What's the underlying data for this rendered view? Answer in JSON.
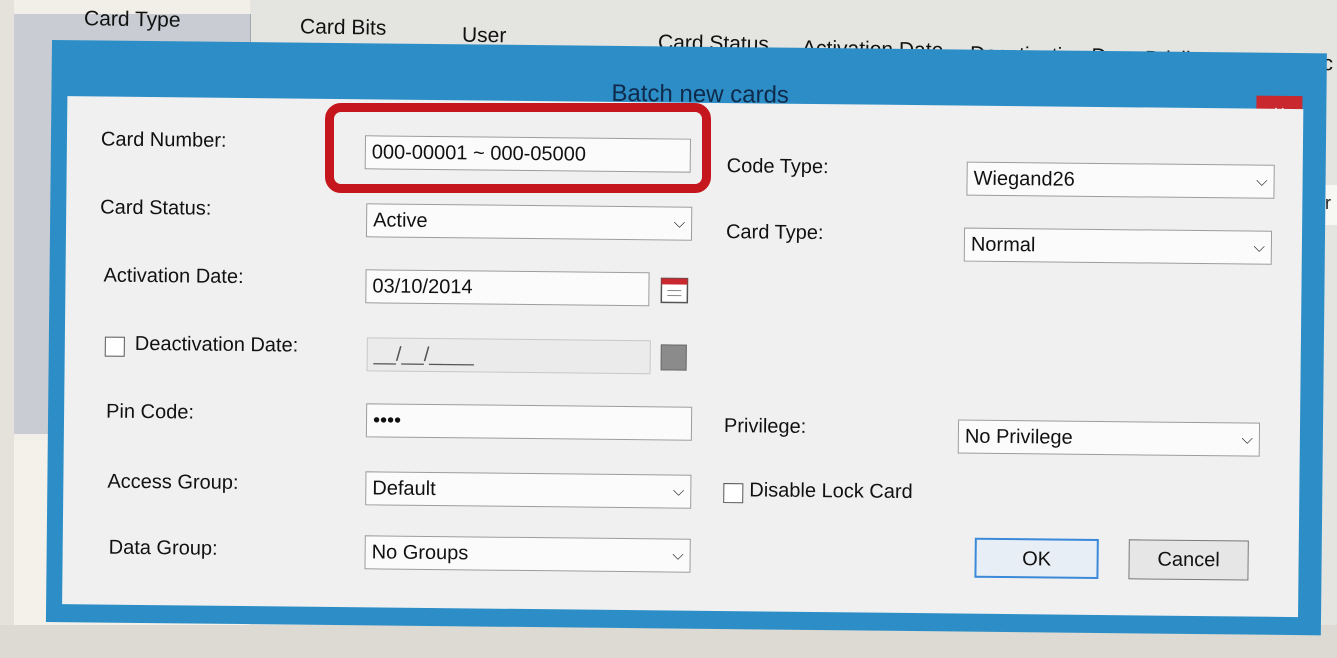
{
  "columns": [
    "Card Type",
    "Card Bits",
    "User",
    "Card Status",
    "Activation Date",
    "Deactivation D...",
    "Privilege",
    "Acc"
  ],
  "bg_fragment": "er",
  "dialog": {
    "title": "Batch new cards",
    "close": "×",
    "card_number": {
      "label": "Card Number:",
      "value": "000-00001 ~ 000-05000"
    },
    "card_status": {
      "label": "Card Status:",
      "value": "Active"
    },
    "activation_date": {
      "label": "Activation Date:",
      "value": "03/10/2014"
    },
    "deactivation_date": {
      "label": "Deactivation Date:",
      "value": "__/__/____",
      "checked": false
    },
    "pin_code": {
      "label": "Pin Code:",
      "value": "••••"
    },
    "access_group": {
      "label": "Access Group:",
      "value": "Default"
    },
    "data_group": {
      "label": "Data Group:",
      "value": "No Groups"
    },
    "code_type": {
      "label": "Code Type:",
      "value": "Wiegand26"
    },
    "card_type": {
      "label": "Card Type:",
      "value": "Normal"
    },
    "privilege": {
      "label": "Privilege:",
      "value": "No Privilege"
    },
    "disable_lock_card": {
      "label": "Disable Lock Card",
      "checked": false
    },
    "ok": "OK",
    "cancel": "Cancel"
  },
  "colors": {
    "title_bar": "#2d8ec7",
    "close": "#c8282e",
    "highlight": "#c4161c",
    "client": "#f0f0f0"
  },
  "icons": {
    "calendar": "calendar-icon",
    "dropdown": "chevron-down-icon",
    "close": "close-icon"
  }
}
